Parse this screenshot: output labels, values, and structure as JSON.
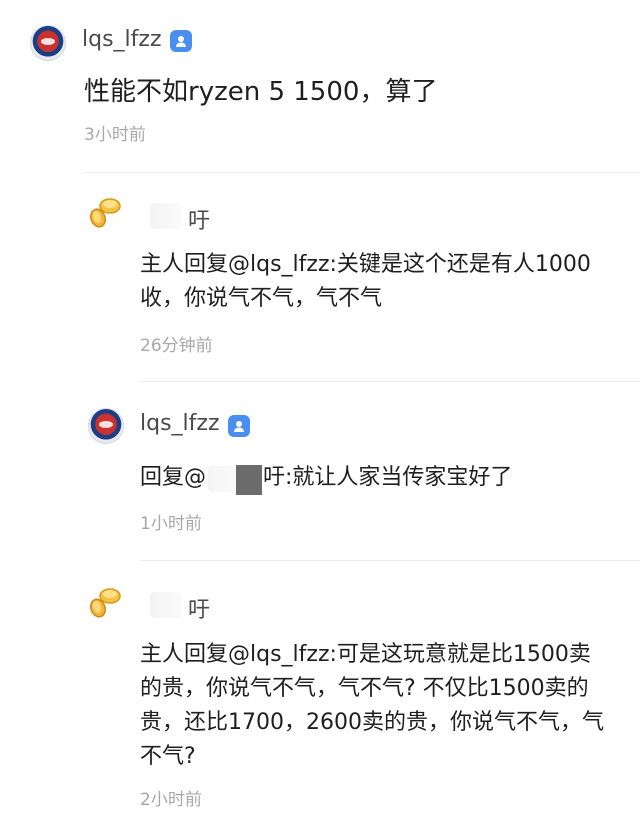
{
  "main_post": {
    "username": "lqs_lfzz",
    "text": "性能不如ryzen 5 1500，算了",
    "time": "3小时前"
  },
  "replies": [
    {
      "username_suffix": "吁",
      "text_line1": "主人回复@lqs_lfzz:关键是这个还是有人1000",
      "text_line2": "收，你说气不气，气不气",
      "time": "26分钟前"
    },
    {
      "username": "lqs_lfzz",
      "text_prefix": "回复@",
      "text_suffix": "吁:就让人家当传家宝好了",
      "time": "1小时前"
    },
    {
      "username_suffix": "吁",
      "text_line1": "主人回复@lqs_lfzz:可是这玩意就是比1500卖",
      "text_line2": "的贵，你说气不气，气不气? 不仅比1500卖的",
      "text_line3": "贵，还比1700，2600卖的贵，你说气不气，气",
      "text_line4": "不气?",
      "time": "2小时前"
    }
  ],
  "icons": {
    "verified_badge": "person-badge-icon",
    "user_avatar": "spiderman-avatar-icon",
    "coin_avatar": "coins-avatar-icon"
  },
  "colors": {
    "badge": "#4a8ef0",
    "time": "#a8a8a8",
    "username": "#4a4a4a"
  }
}
